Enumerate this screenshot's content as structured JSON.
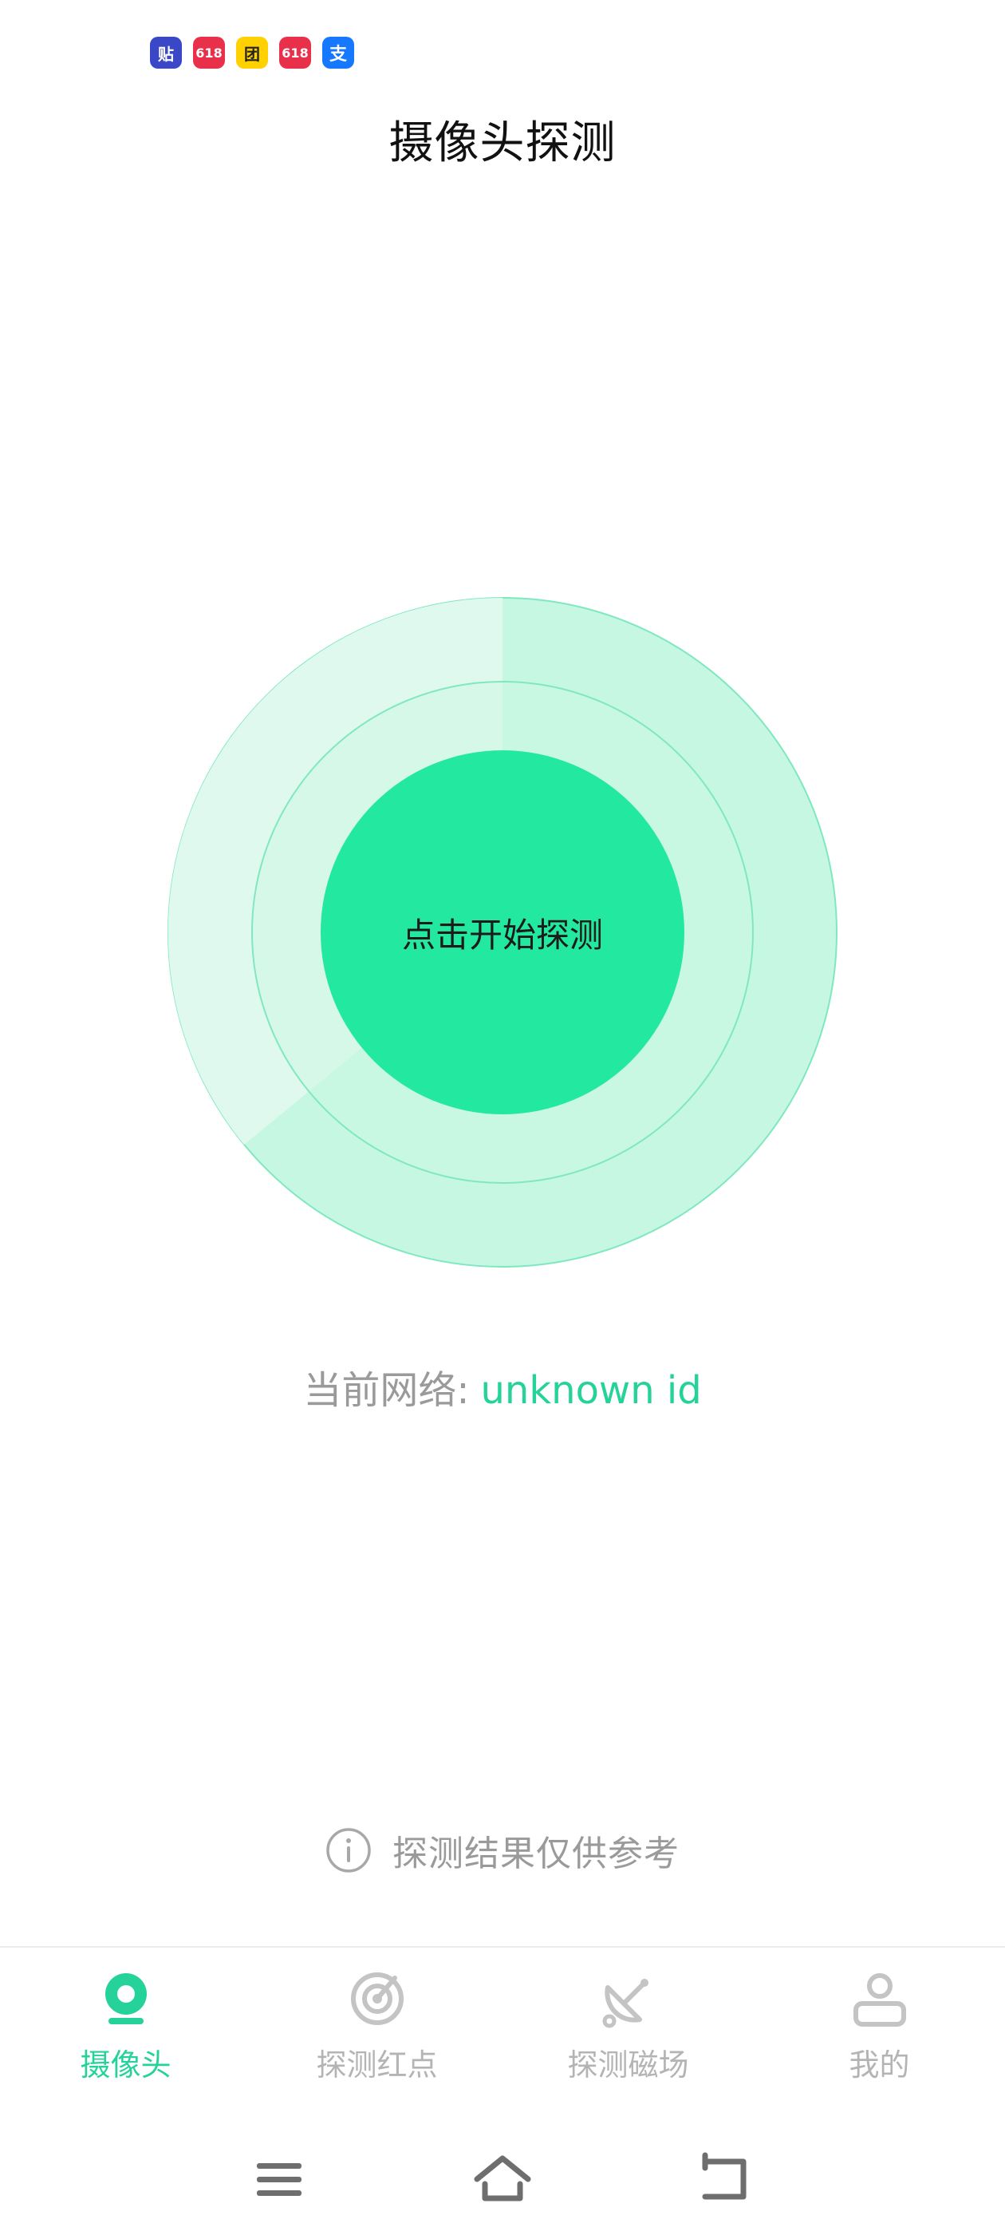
{
  "status_bar": {
    "notification_icons": [
      {
        "name": "tieba-app-icon",
        "glyph": "贴",
        "bg": "#3a48c8"
      },
      {
        "name": "tmall-618-icon",
        "glyph": "618",
        "bg": "#e8304a"
      },
      {
        "name": "meituan-app-icon",
        "glyph": "团",
        "bg": "#ffd100"
      },
      {
        "name": "taobao-618-icon",
        "glyph": "618",
        "bg": "#e8304a"
      },
      {
        "name": "alipay-app-icon",
        "glyph": "支",
        "bg": "#1677ff"
      }
    ]
  },
  "header": {
    "title": "摄像头探测"
  },
  "scanner": {
    "button_label": "点击开始探测"
  },
  "network": {
    "label": "当前网络:",
    "value": "unknown id"
  },
  "disclaimer": {
    "text": "探测结果仅供参考",
    "icon": "info-icon"
  },
  "tabs": [
    {
      "label": "摄像头",
      "icon": "camera-icon",
      "active": true
    },
    {
      "label": "探测红点",
      "icon": "radar-icon",
      "active": false
    },
    {
      "label": "探测磁场",
      "icon": "satellite-dish-icon",
      "active": false
    },
    {
      "label": "我的",
      "icon": "user-icon",
      "active": false
    }
  ],
  "nav": {
    "buttons": [
      "menu-icon",
      "home-icon",
      "back-icon"
    ]
  },
  "colors": {
    "accent": "#25d39a",
    "accent_light": "#c6f7e2",
    "inactive": "#b4b4b4",
    "muted_text": "#9a9a9a"
  }
}
